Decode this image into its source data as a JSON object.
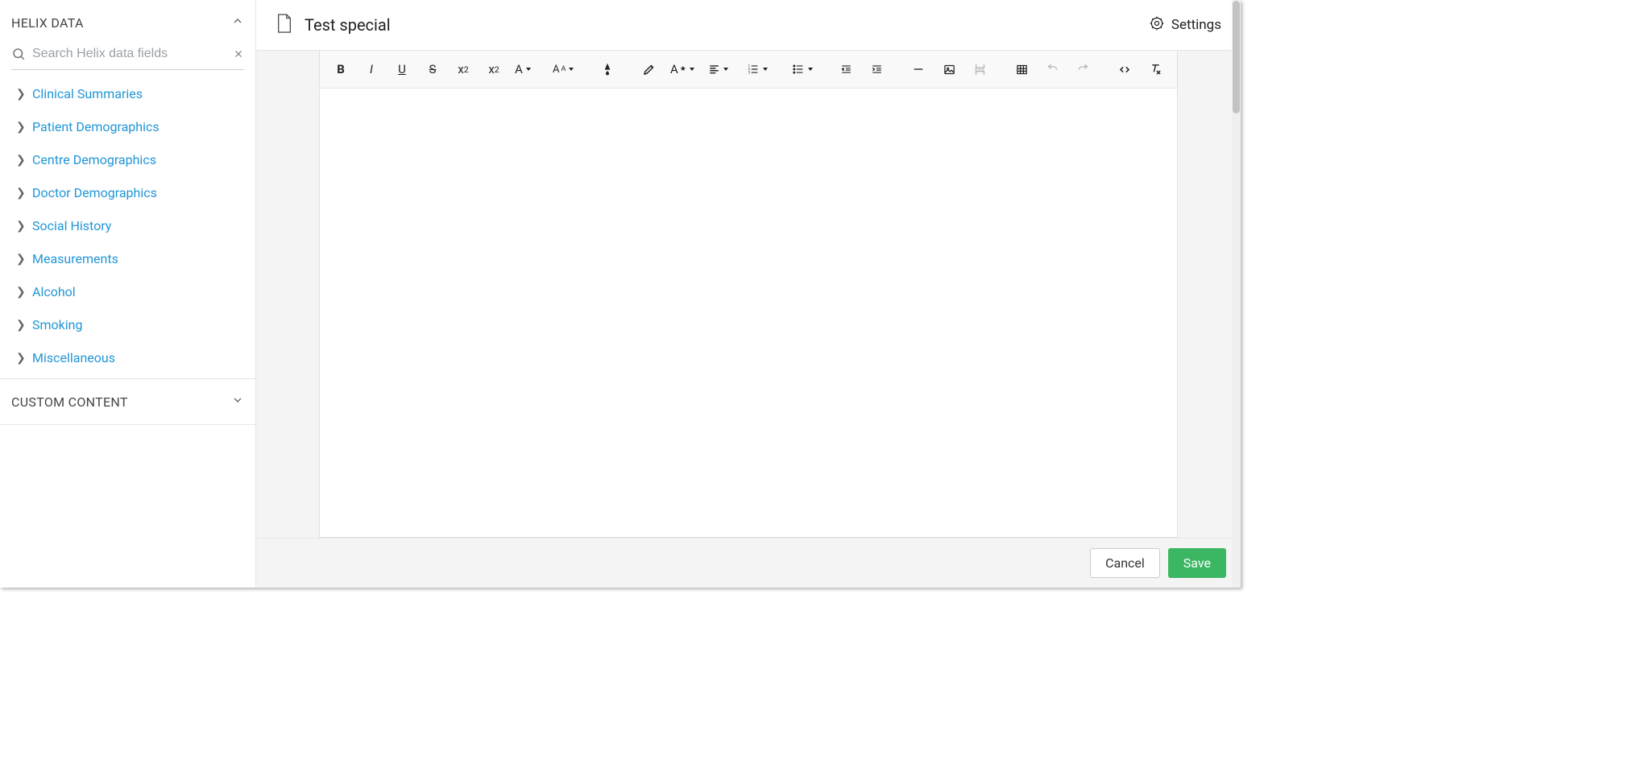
{
  "sidebar": {
    "panel_title": "HELIX DATA",
    "search_placeholder": "Search Helix data fields",
    "categories": [
      {
        "label": "Clinical Summaries"
      },
      {
        "label": "Patient Demographics"
      },
      {
        "label": "Centre Demographics"
      },
      {
        "label": "Doctor Demographics"
      },
      {
        "label": "Social History"
      },
      {
        "label": "Measurements"
      },
      {
        "label": "Alcohol"
      },
      {
        "label": "Smoking"
      },
      {
        "label": "Miscellaneous"
      }
    ],
    "custom_panel_title": "CUSTOM CONTENT"
  },
  "header": {
    "doc_title": "Test special",
    "settings_label": "Settings"
  },
  "footer": {
    "cancel_label": "Cancel",
    "save_label": "Save"
  },
  "toolbar": {
    "items": [
      {
        "name": "bold"
      },
      {
        "name": "italic"
      },
      {
        "name": "underline"
      },
      {
        "name": "strikethrough"
      },
      {
        "name": "subscript"
      },
      {
        "name": "superscript"
      },
      {
        "name": "font-family"
      },
      {
        "name": "font-size"
      },
      {
        "name": "font-color"
      },
      {
        "name": "highlight"
      },
      {
        "name": "styles"
      },
      {
        "name": "align"
      },
      {
        "name": "ordered-list"
      },
      {
        "name": "unordered-list"
      },
      {
        "name": "outdent"
      },
      {
        "name": "indent"
      },
      {
        "name": "horizontal-rule"
      },
      {
        "name": "image"
      },
      {
        "name": "page-break"
      },
      {
        "name": "table"
      },
      {
        "name": "undo"
      },
      {
        "name": "redo"
      },
      {
        "name": "source"
      },
      {
        "name": "clear-format"
      }
    ]
  }
}
